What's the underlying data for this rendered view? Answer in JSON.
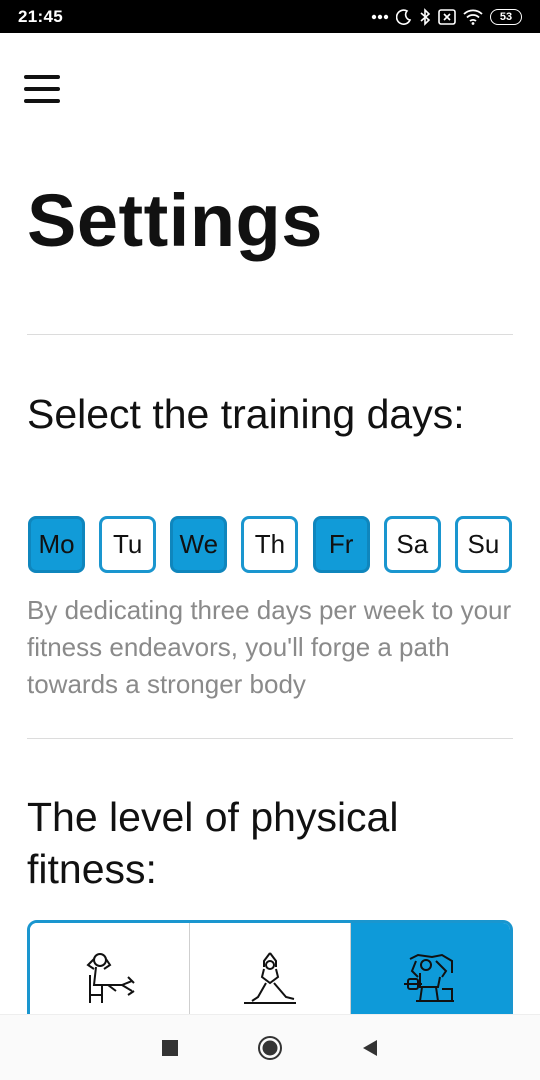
{
  "status_bar": {
    "time": "21:45",
    "battery": "53",
    "icons": [
      "more-dots-icon",
      "moon-icon",
      "bluetooth-icon",
      "sim-icon",
      "wifi-icon",
      "battery-icon"
    ]
  },
  "header": {
    "menu_icon": "hamburger-menu-icon"
  },
  "page": {
    "title": "Settings"
  },
  "training_days": {
    "heading": "Select the training days:",
    "days": [
      {
        "label": "Mo",
        "selected": true
      },
      {
        "label": "Tu",
        "selected": false
      },
      {
        "label": "We",
        "selected": true
      },
      {
        "label": "Th",
        "selected": false
      },
      {
        "label": "Fr",
        "selected": true
      },
      {
        "label": "Sa",
        "selected": false
      },
      {
        "label": "Su",
        "selected": false
      }
    ],
    "note": "By dedicating three days per week to your fitness endeavors, you'll forge a path towards a stronger body"
  },
  "fitness_level": {
    "heading": "The level of physical fitness:",
    "options": [
      {
        "icon": "person-sitting-chair-icon",
        "selected": false
      },
      {
        "icon": "person-stretching-icon",
        "selected": false
      },
      {
        "icon": "person-weightlifting-icon",
        "selected": true
      }
    ]
  },
  "colors": {
    "accent": "#119bd8",
    "accent_border": "#1a96cf",
    "note_text": "#8a8a8a"
  },
  "nav_bar": {
    "buttons": [
      "recents-square-icon",
      "home-circle-icon",
      "back-triangle-icon"
    ]
  }
}
